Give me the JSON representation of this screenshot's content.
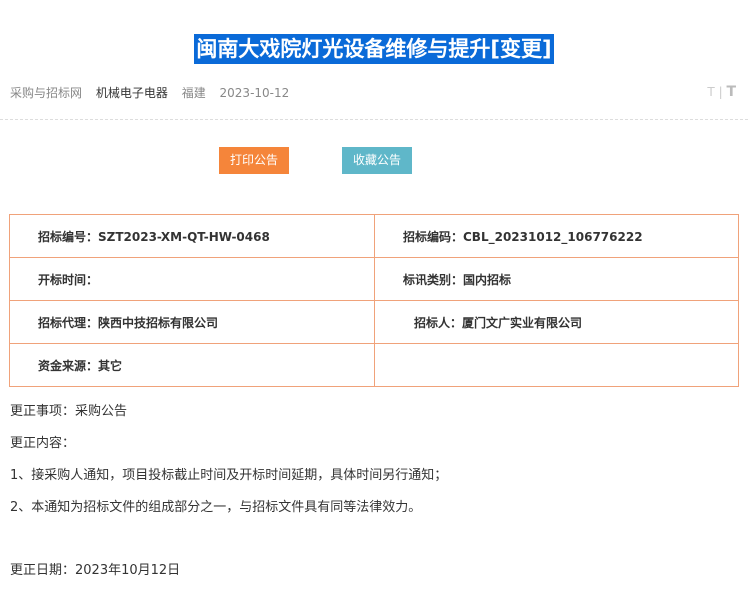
{
  "title": "闽南大戏院灯光设备维修与提升[变更]",
  "meta": {
    "source": "采购与招标网",
    "category": "机械电子电器",
    "region": "福建",
    "date": "2023-10-12"
  },
  "font_tools": {
    "small": "T",
    "separator": "|",
    "big": "T"
  },
  "buttons": {
    "print": "打印公告",
    "favorite": "收藏公告"
  },
  "info_table": {
    "rows": [
      [
        "招标编号：SZT2023-XM-QT-HW-0468",
        "招标编码：CBL_20231012_106776222"
      ],
      [
        "开标时间：",
        "标讯类别：国内招标"
      ],
      [
        "招标代理：陕西中技招标有限公司",
        "招标人：厦门文广实业有限公司"
      ],
      [
        "资金来源：其它",
        ""
      ]
    ]
  },
  "content": {
    "item": "更正事项：采购公告",
    "heading": "更正内容：",
    "line1": "1、接采购人通知，项目投标截止时间及开标时间延期，具体时间另行通知；",
    "line2": "2、本通知为招标文件的组成部分之一，与招标文件具有同等法律效力。",
    "date": "更正日期：2023年10月12日"
  }
}
